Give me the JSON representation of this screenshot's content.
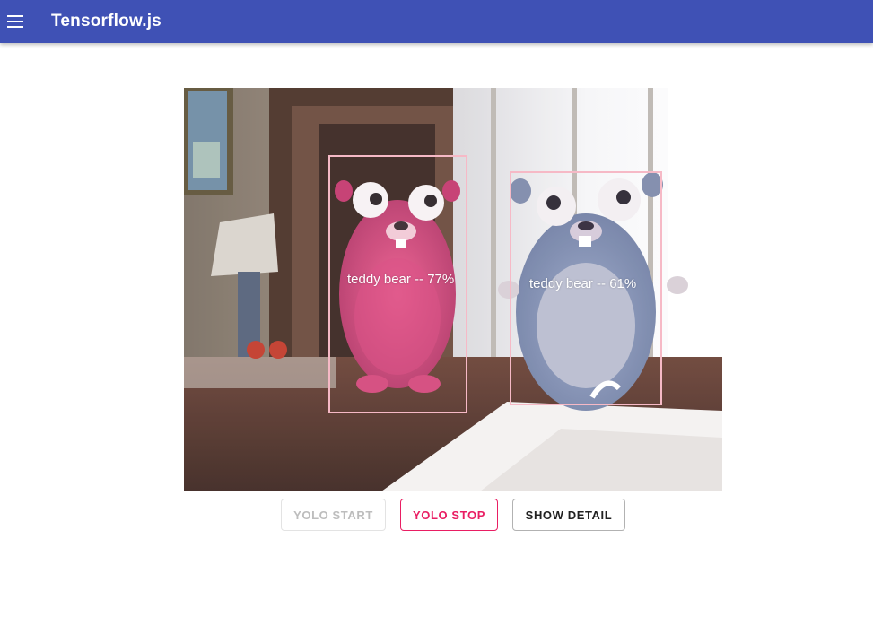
{
  "app": {
    "title": "Tensorflow.js",
    "header_color": "#3f51b5"
  },
  "detections": [
    {
      "label": "teddy bear -- 77%",
      "color": "#f6b9c6"
    },
    {
      "label": "teddy bear -- 61%",
      "color": "#f6b9c6"
    }
  ],
  "controls": {
    "start_label": "YOLO START",
    "stop_label": "YOLO STOP",
    "detail_label": "SHOW DETAIL",
    "accent": "#e91e63"
  }
}
